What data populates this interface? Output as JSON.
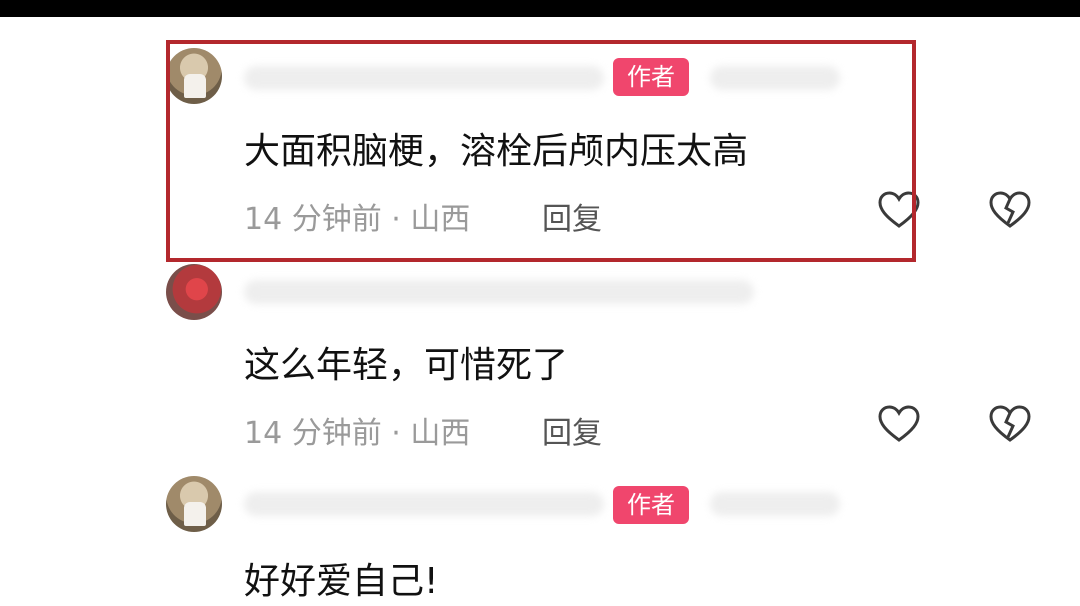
{
  "colors": {
    "highlight": "#b3282d",
    "badge": "#f0466d",
    "meta": "#9a9a9a"
  },
  "comments": [
    {
      "is_author": true,
      "badge": "作者",
      "text": "大面积脑梗，溶栓后颅内压太高",
      "meta": "14 分钟前 · 山西",
      "reply": "回复",
      "icons": [
        "heart-outline-icon",
        "broken-heart-icon"
      ]
    },
    {
      "is_author": false,
      "text": "这么年轻，可惜死了",
      "meta": "14 分钟前 · 山西",
      "reply": "回复",
      "icons": [
        "heart-outline-icon",
        "broken-heart-icon"
      ]
    },
    {
      "is_author": true,
      "badge": "作者",
      "text": "好好爱自己!"
    }
  ]
}
